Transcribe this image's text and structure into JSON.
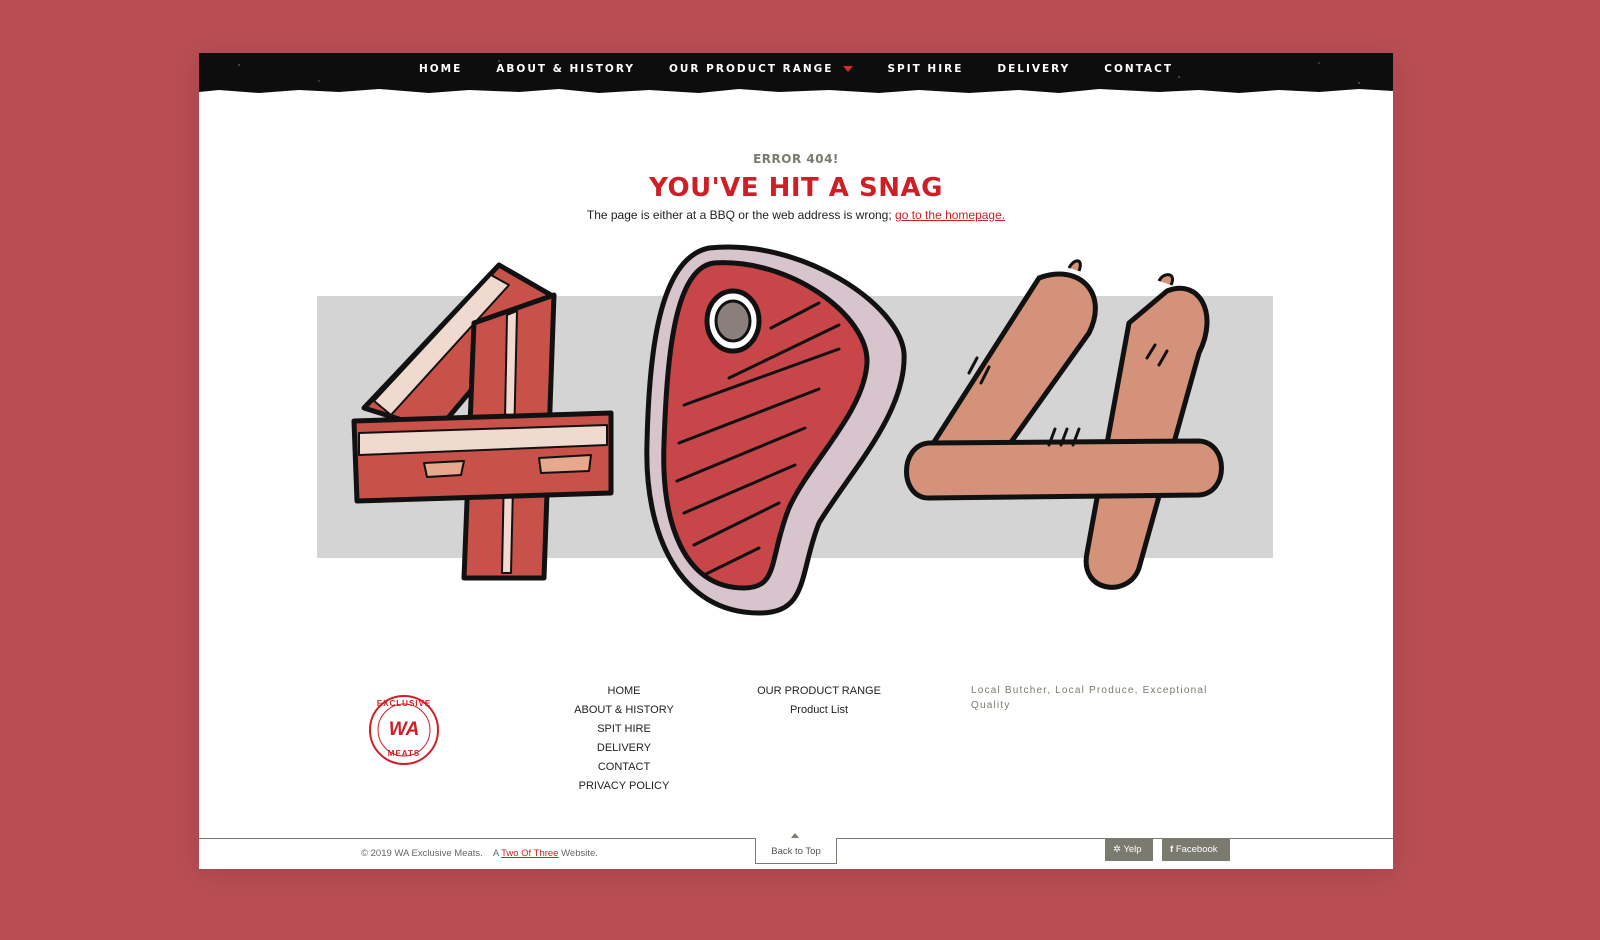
{
  "nav": {
    "items": [
      {
        "label": "HOME"
      },
      {
        "label": "ABOUT & HISTORY"
      },
      {
        "label": "OUR PRODUCT RANGE"
      },
      {
        "label": "SPIT HIRE"
      },
      {
        "label": "DELIVERY"
      },
      {
        "label": "CONTACT"
      }
    ],
    "accent": "#d42a2a"
  },
  "error": {
    "label": "ERROR 404!",
    "title": "YOU'VE HIT A SNAG",
    "description": "The page is either at a BBQ or the web address is wrong; ",
    "link": "go to the homepage."
  },
  "footer": {
    "logo": {
      "top": "EXCLUSIVE",
      "center": "WA",
      "bottom": "MEATS"
    },
    "col1": [
      "HOME",
      "ABOUT & HISTORY",
      "SPIT HIRE",
      "DELIVERY",
      "CONTACT",
      "PRIVACY POLICY"
    ],
    "col2": [
      "OUR PRODUCT RANGE",
      "Product List"
    ],
    "tagline": "Local Butcher, Local Produce, Exceptional Quality",
    "copyright": "© 2019 WA Exclusive Meats.",
    "credit_prefix": "A",
    "credit_link": "Two Of Three",
    "credit_suffix": "Website.",
    "back_to_top": "Back to Top",
    "yelp": "Yelp",
    "facebook": "Facebook"
  },
  "colors": {
    "background": "#b84e54",
    "brand_red": "#cf1f26",
    "muted": "#7a7a6e"
  }
}
